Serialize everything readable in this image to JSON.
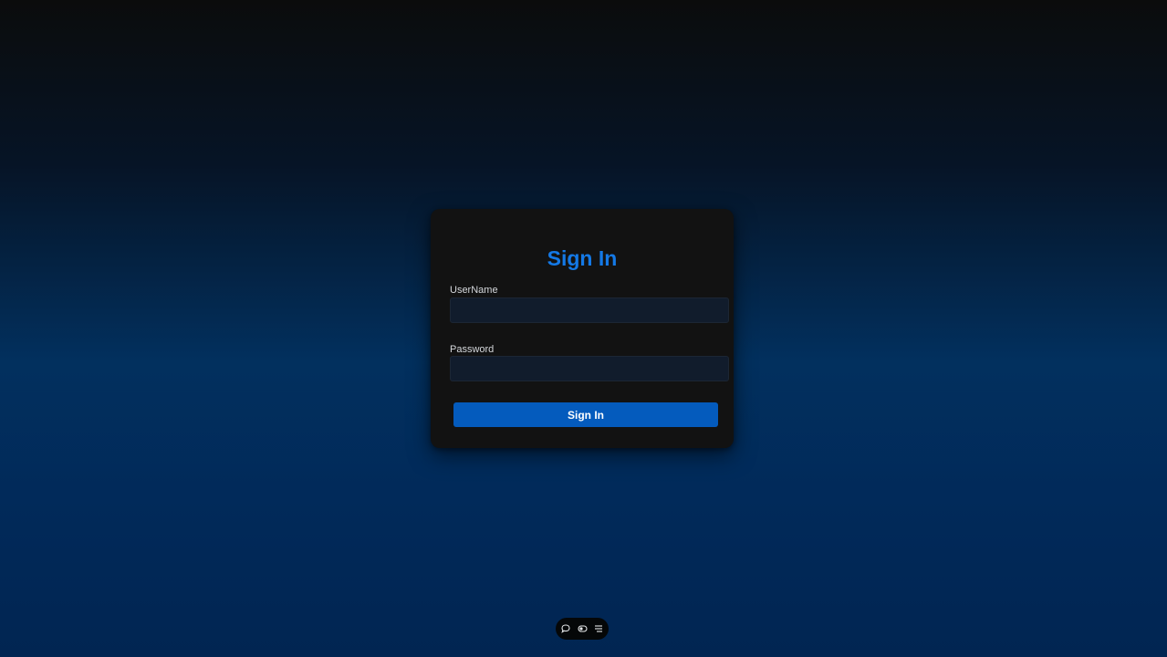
{
  "login": {
    "title": "Sign In",
    "username_label": "UserName",
    "username_value": "",
    "password_label": "Password",
    "password_value": "",
    "submit_label": "Sign In"
  },
  "toolbar": {
    "icons": [
      "chat-icon",
      "toggle-icon",
      "menu-icon"
    ]
  },
  "colors": {
    "accent": "#1479e6",
    "button": "#045bbd",
    "card": "#121212",
    "input": "#111c2c"
  }
}
